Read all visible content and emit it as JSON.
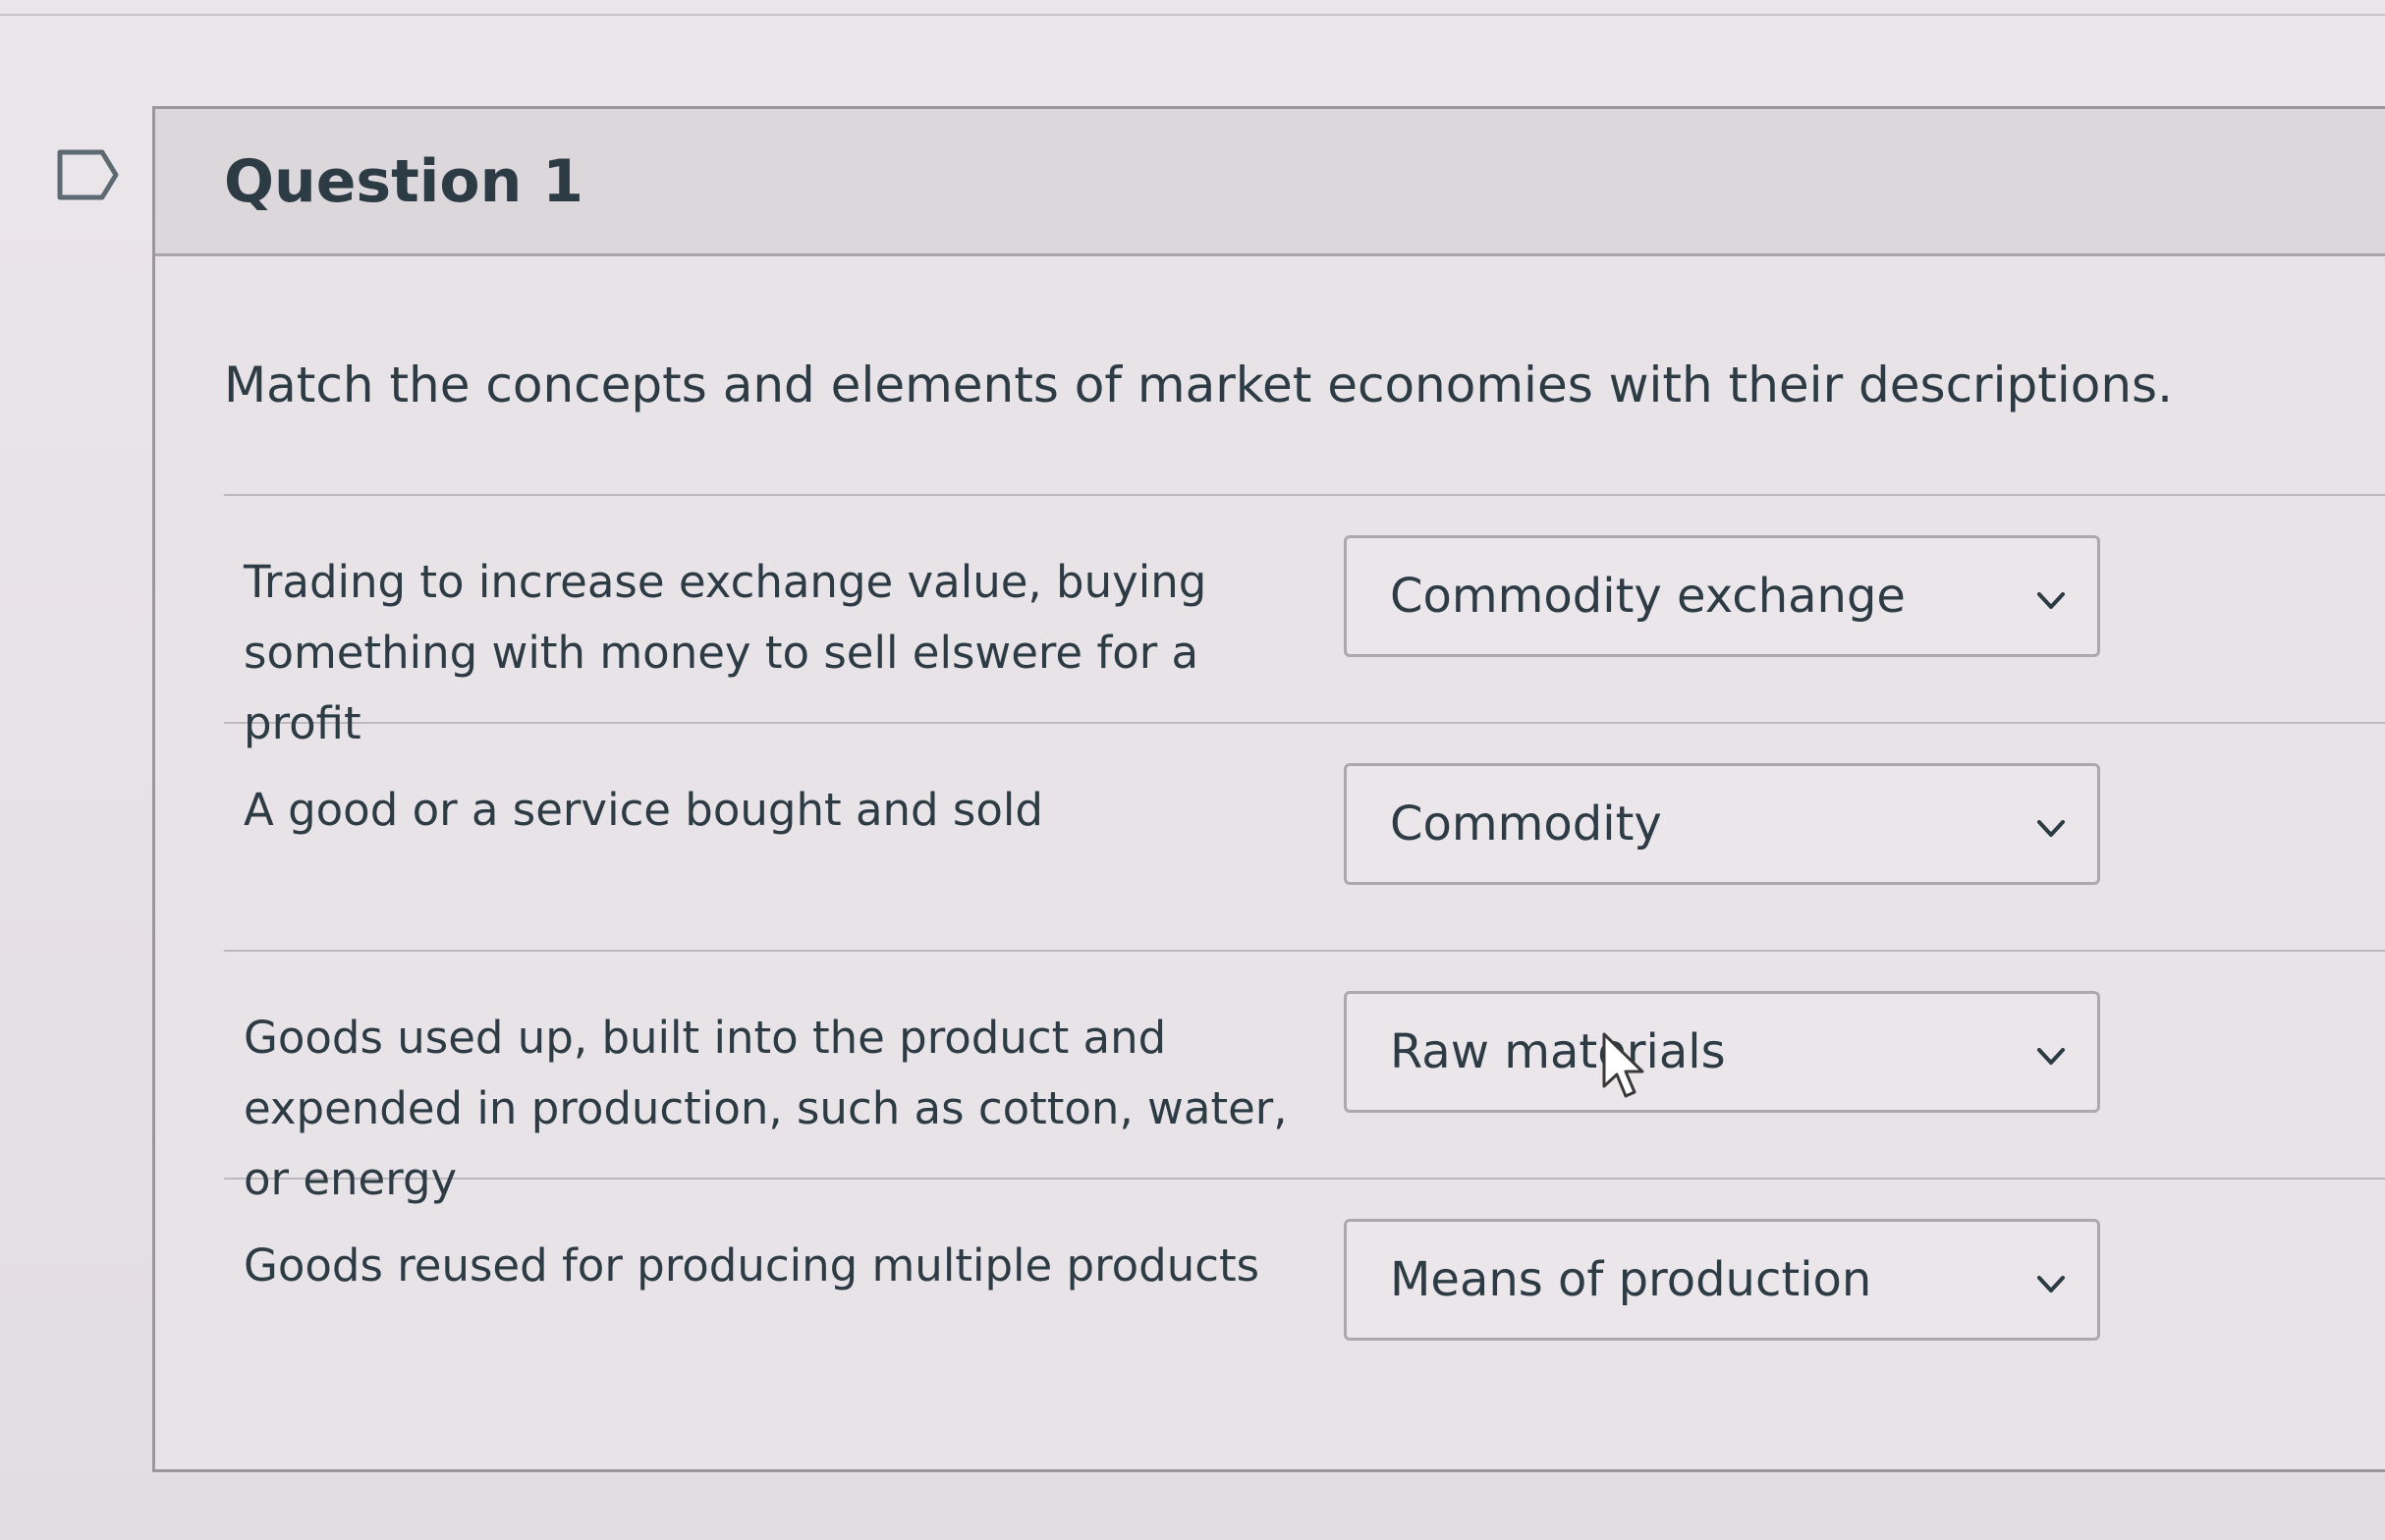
{
  "question": {
    "title": "Question 1",
    "prompt": "Match the concepts and elements of market economies with their descriptions.",
    "flag_icon": "flag-outline-icon",
    "rows": [
      {
        "description": "Trading to increase exchange value, buying something with money to sell elswere for a profit",
        "selected": "Commodity exchange"
      },
      {
        "description": "A good or a service bought and sold",
        "selected": "Commodity"
      },
      {
        "description": "Goods used up, built into the product and expended in production, such as cotton, water, or energy",
        "selected": "Raw materials"
      },
      {
        "description": "Goods reused for producing multiple products",
        "selected": "Means of production"
      }
    ]
  }
}
